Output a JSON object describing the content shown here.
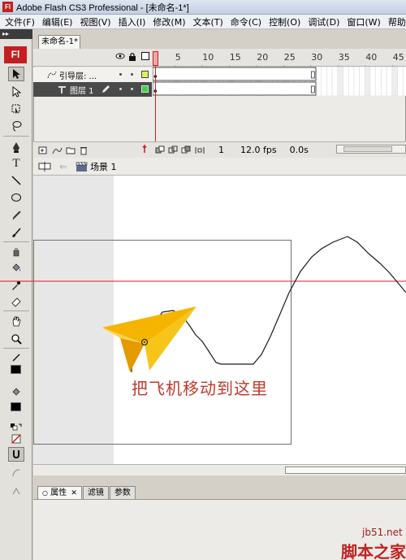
{
  "window": {
    "title": "Adobe Flash CS3 Professional - [未命名-1*]",
    "app_icon": "Fl"
  },
  "menu": [
    "文件(F)",
    "编辑(E)",
    "视图(V)",
    "插入(I)",
    "修改(M)",
    "文本(T)",
    "命令(C)",
    "控制(O)",
    "调试(D)",
    "窗口(W)",
    "帮助(H)"
  ],
  "tools": {
    "logo": "Fl",
    "panel_grip": "▸▸"
  },
  "document_tab": "未命名-1*",
  "timeline": {
    "frame_numbers": [
      "5",
      "10",
      "15",
      "20",
      "25",
      "30",
      "35",
      "40",
      "45"
    ],
    "layers": [
      {
        "name": "引导层: ...",
        "type": "guide-layer"
      },
      {
        "name": "图层 1",
        "type": "normal-layer"
      }
    ],
    "status": {
      "current_frame": "1",
      "fps": "12.0 fps",
      "time": "0.0s"
    }
  },
  "editbar": {
    "scene_label": "场景 1"
  },
  "stage": {
    "annotation": "把飞机移动到这里",
    "annotation_color": "#c0392b"
  },
  "properties": {
    "tabs": [
      "属性",
      "滤镜",
      "参数"
    ]
  },
  "watermark": {
    "site": "jb51.net",
    "text": "脚本之家"
  },
  "colors": {
    "guide_line": "#d02020",
    "layer_selected": "#4a4a4a",
    "plane_yellow": "#f5b400"
  }
}
